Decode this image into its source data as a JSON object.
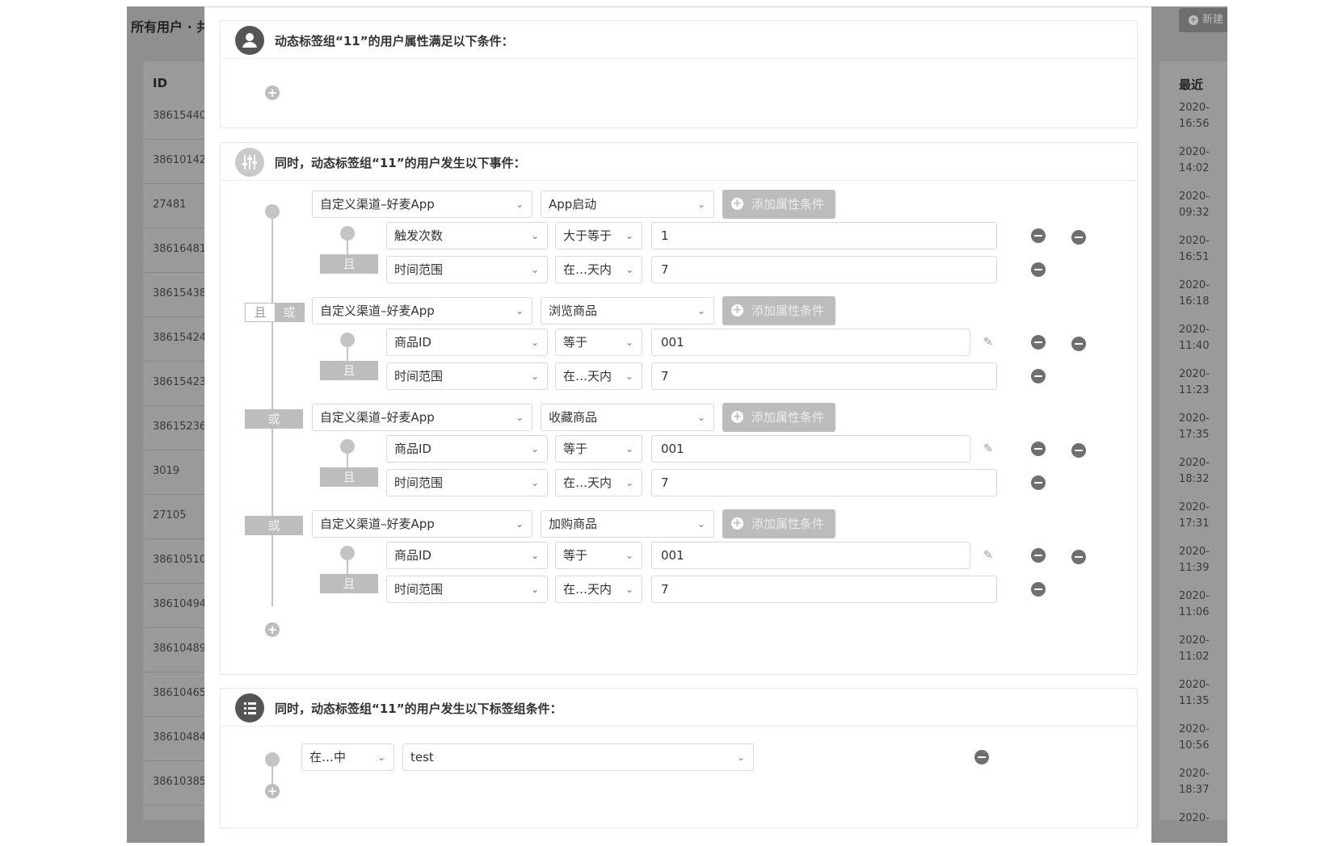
{
  "background": {
    "title": "所有用户 · 共",
    "new_button": "新建",
    "col_id": "ID",
    "col_recent": "最近",
    "ids": [
      "38615440",
      "38610142",
      "27481",
      "38616481",
      "38615438",
      "38615424",
      "38615423",
      "38615236",
      "3019",
      "27105",
      "38610510",
      "38610494",
      "38610489",
      "38610465",
      "38610484",
      "38610385"
    ],
    "times": [
      [
        "2020-",
        "16:56"
      ],
      [
        "2020-",
        "14:02"
      ],
      [
        "2020-",
        "09:32"
      ],
      [
        "2020-",
        "16:51"
      ],
      [
        "2020-",
        "16:18"
      ],
      [
        "2020-",
        "11:40"
      ],
      [
        "2020-",
        "11:23"
      ],
      [
        "2020-",
        "17:35"
      ],
      [
        "2020-",
        "18:32"
      ],
      [
        "2020-",
        "17:31"
      ],
      [
        "2020-",
        "11:39"
      ],
      [
        "2020-",
        "11:06"
      ],
      [
        "2020-",
        "11:02"
      ],
      [
        "2020-",
        "11:35"
      ],
      [
        "2020-",
        "10:56"
      ],
      [
        "2020-",
        "18:37"
      ],
      [
        "2020-",
        ""
      ]
    ]
  },
  "attr_section": {
    "title": "动态标签组“11”的用户属性满足以下条件："
  },
  "event_section": {
    "title": "同时，动态标签组“11”的用户发生以下事件：",
    "and_label": "且",
    "or_label": "或",
    "add_condition_label": "添加属性条件",
    "events": [
      {
        "channel": "自定义渠道–好麦App",
        "event": "App启动",
        "conditions": [
          {
            "field": "触发次数",
            "op": "大于等于",
            "value": "1"
          },
          {
            "field": "时间范围",
            "op": "在…天内",
            "value": "7"
          }
        ]
      },
      {
        "channel": "自定义渠道–好麦App",
        "event": "浏览商品",
        "conditions": [
          {
            "field": "商品ID",
            "op": "等于",
            "value": "001"
          },
          {
            "field": "时间范围",
            "op": "在…天内",
            "value": "7"
          }
        ]
      },
      {
        "channel": "自定义渠道–好麦App",
        "event": "收藏商品",
        "conditions": [
          {
            "field": "商品ID",
            "op": "等于",
            "value": "001"
          },
          {
            "field": "时间范围",
            "op": "在…天内",
            "value": "7"
          }
        ]
      },
      {
        "channel": "自定义渠道–好麦App",
        "event": "加购商品",
        "conditions": [
          {
            "field": "商品ID",
            "op": "等于",
            "value": "001"
          },
          {
            "field": "时间范围",
            "op": "在…天内",
            "value": "7"
          }
        ]
      }
    ]
  },
  "tag_section": {
    "title": "同时，动态标签组“11”的用户发生以下标签组条件：",
    "op": "在…中",
    "value": "test"
  },
  "icons": {
    "attr_section": "user-group-icon",
    "event_section": "sliders-icon",
    "tag_section": "list-icon"
  }
}
